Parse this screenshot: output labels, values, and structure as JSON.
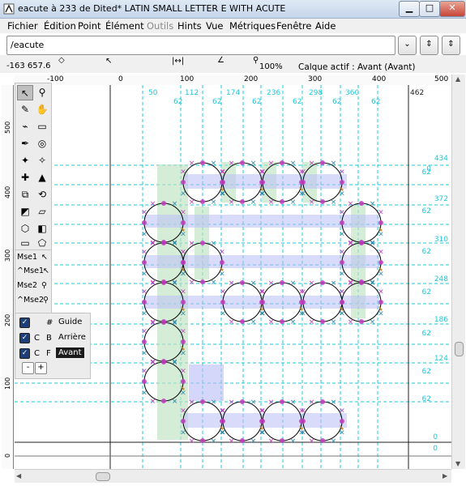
{
  "window": {
    "title": "eacute à 233 de Dited* LATIN SMALL LETTER E WITH ACUTE"
  },
  "menu": [
    "Fichier",
    "Édition",
    "Point",
    "Élément",
    "Outils",
    "Hints",
    "Vue",
    "Métriques",
    "Fenêtre",
    "Aide"
  ],
  "glyph_field": {
    "value": "/eacute"
  },
  "info": {
    "coords": "-163 657.6",
    "zoom": "100%",
    "active_layer": "Calque actif : Avant (Avant)"
  },
  "hruler": [
    "-100",
    "0",
    "100",
    "200",
    "300",
    "400",
    "500"
  ],
  "vruler": [
    "500",
    "400",
    "300",
    "200",
    "100",
    "0"
  ],
  "hint_top_positions": [
    "50",
    "112",
    "174",
    "236",
    "298",
    "360"
  ],
  "hint_top_widths": [
    "62",
    "62",
    "62",
    "62",
    "62",
    "62"
  ],
  "advance_label": "462",
  "hint_right_positions": [
    "434",
    "372",
    "310",
    "248",
    "186",
    "124"
  ],
  "hint_right_widths": [
    "62",
    "62",
    "62",
    "62",
    "62",
    "62",
    "62"
  ],
  "baseline_labels": [
    "0",
    "0"
  ],
  "top_zero": "0",
  "ctl_labels": [
    "Mse1",
    "^Mse1",
    "Mse2",
    "^Mse2"
  ],
  "layers": [
    {
      "sym": "#",
      "name": "Guide",
      "active": false
    },
    {
      "sym": "C",
      "sym2": "B",
      "name": "Arrière",
      "active": false
    },
    {
      "sym": "C",
      "sym2": "F",
      "name": "Avant",
      "active": true
    }
  ],
  "layer_buttons": [
    "-",
    "+"
  ],
  "colors": {
    "hint_cyan": "#1ec8d8",
    "hstem_blue": "#b9bdf7",
    "vstem_green": "#bfe3c0",
    "point_magenta": "#c23bbf",
    "control_x": "#2f88a8"
  }
}
